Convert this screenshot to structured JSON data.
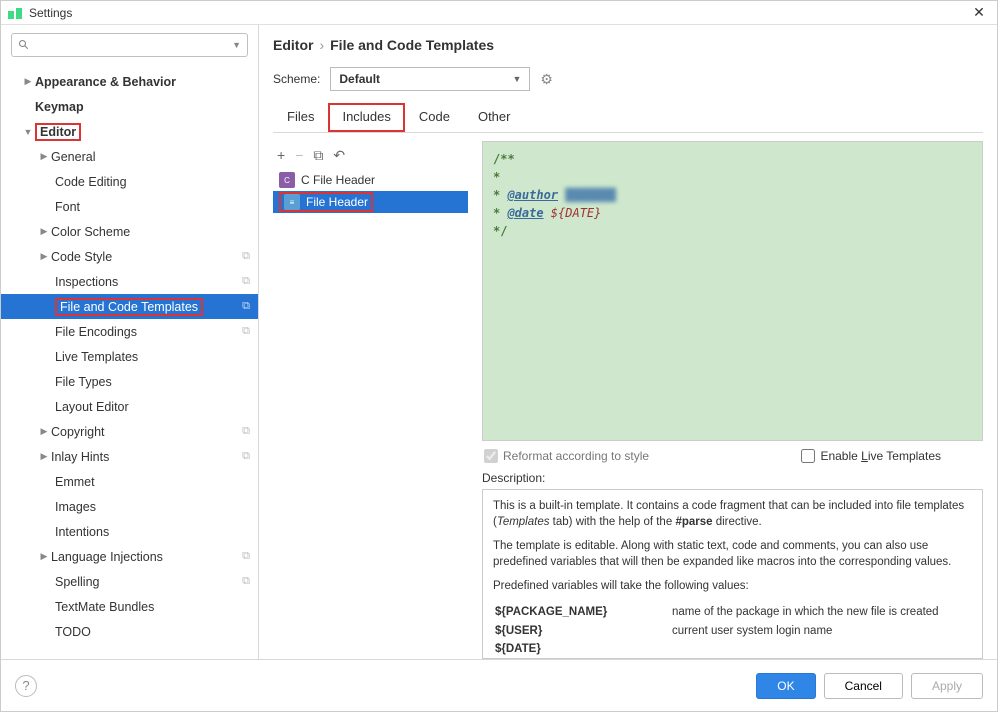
{
  "window": {
    "title": "Settings"
  },
  "breadcrumb": {
    "part1": "Editor",
    "part2": "File and Code Templates"
  },
  "scheme": {
    "label": "Scheme:",
    "value": "Default"
  },
  "tabs": {
    "files": "Files",
    "includes": "Includes",
    "code": "Code",
    "other": "Other"
  },
  "sidebar": {
    "appearance": "Appearance & Behavior",
    "keymap": "Keymap",
    "editor": "Editor",
    "general": "General",
    "code_editing": "Code Editing",
    "font": "Font",
    "color_scheme": "Color Scheme",
    "code_style": "Code Style",
    "inspections": "Inspections",
    "file_code_templates": "File and Code Templates",
    "file_encodings": "File Encodings",
    "live_templates": "Live Templates",
    "file_types": "File Types",
    "layout_editor": "Layout Editor",
    "copyright": "Copyright",
    "inlay_hints": "Inlay Hints",
    "emmet": "Emmet",
    "images": "Images",
    "intentions": "Intentions",
    "language_injections": "Language Injections",
    "spelling": "Spelling",
    "textmate": "TextMate Bundles",
    "todo": "TODO"
  },
  "templates": {
    "c_header": "C File Header",
    "file_header": "File Header"
  },
  "code": {
    "l1": "/**",
    "l2": " *",
    "l3a": " * ",
    "l3tag": "@author",
    "l3blur": " ███████",
    "l4a": " * ",
    "l4tag": "@date",
    "l4var": " ${DATE}",
    "l5": " */"
  },
  "checks": {
    "reformat": "Reformat according to style",
    "live": "Enable Live Templates",
    "live_u": "L"
  },
  "desc": {
    "label": "Description:",
    "p1a": "This is a built-in template. It contains a code fragment that can be included into file templates (",
    "p1i": "Templates",
    "p1b": " tab) with the help of the ",
    "p1bold": "#parse",
    "p1c": " directive.",
    "p2": "The template is editable. Along with static text, code and comments, you can also use predefined variables that will then be expanded like macros into the corresponding values.",
    "p3": "Predefined variables will take the following values:",
    "vars": [
      {
        "name": "${PACKAGE_NAME}",
        "desc": "name of the package in which the new file is created"
      },
      {
        "name": "${USER}",
        "desc": "current user system login name"
      },
      {
        "name": "${DATE}",
        "desc": ""
      }
    ]
  },
  "footer": {
    "ok": "OK",
    "cancel": "Cancel",
    "apply": "Apply"
  }
}
